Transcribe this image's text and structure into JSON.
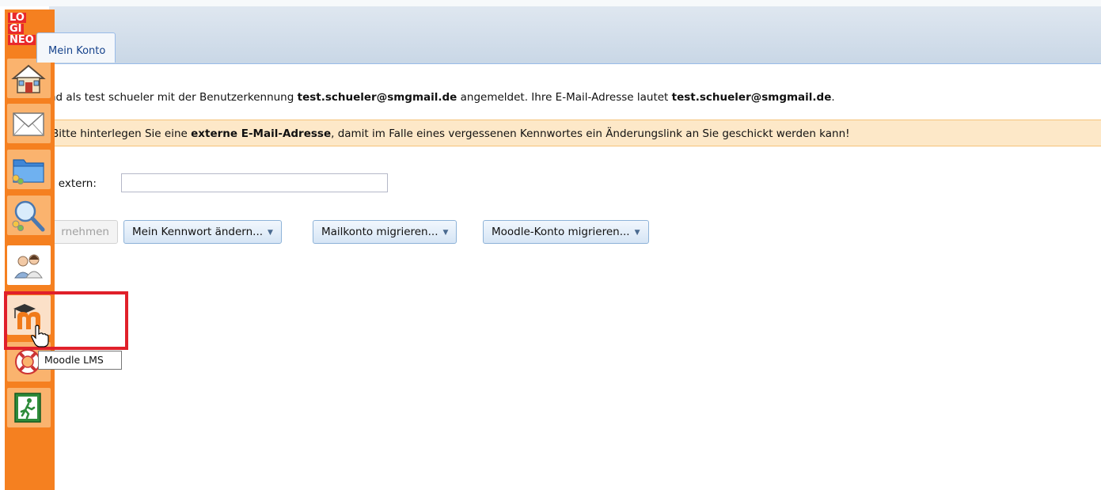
{
  "app": {
    "logo_lines": [
      "LO",
      "GI",
      "NEO"
    ]
  },
  "tabs": [
    {
      "label": "Mein Konto"
    }
  ],
  "account": {
    "intro_text": "nd als test schueler mit der Benutzerkennung ",
    "user_id": "test.schueler@smgmail.de",
    "mid_text": " angemeldet. Ihre E-Mail-Adresse lautet ",
    "email": "test.schueler@smgmail.de",
    "end_text": "."
  },
  "warning": {
    "prefix": "Bitte hinterlegen Sie eine ",
    "emphasis": "externe E-Mail-Adresse",
    "suffix": ", damit im Falle eines vergessenen Kennwortes ein Änderungslink an Sie geschickt werden kann!"
  },
  "form": {
    "email_extern_label": "il extern:",
    "email_extern_value": ""
  },
  "buttons": {
    "apply": "rnehmen",
    "change_password": "Mein Kennwort ändern...",
    "migrate_mail": "Mailkonto migrieren...",
    "migrate_moodle": "Moodle-Konto migrieren..."
  },
  "sidebar": {
    "items": [
      {
        "icon": "home-icon"
      },
      {
        "icon": "mail-icon"
      },
      {
        "icon": "folder-icon"
      },
      {
        "icon": "search-icon"
      },
      {
        "icon": "users-icon"
      },
      {
        "icon": "moodle-icon"
      },
      {
        "icon": "help-lifebuoy-icon"
      },
      {
        "icon": "exit-icon"
      }
    ],
    "tooltip": "Moodle LMS"
  },
  "colors": {
    "sidebar": "#f58020",
    "logo_red": "#e9292b",
    "warning_bg": "#fde8c8",
    "highlight": "#e0202a",
    "tab_text": "#15428b"
  }
}
